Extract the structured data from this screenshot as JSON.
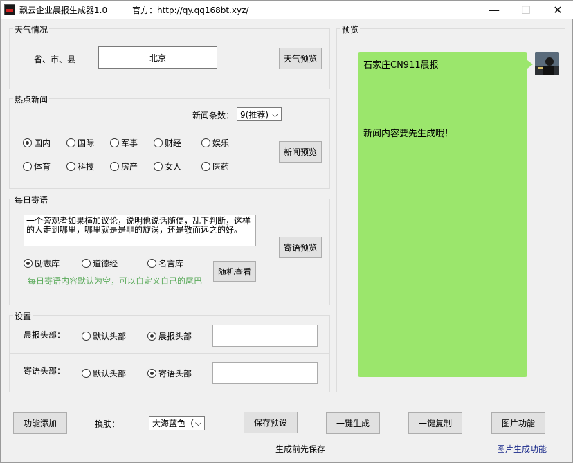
{
  "window": {
    "title": "飘云企业晨报生成器1.0",
    "official_site": "官方：http://qy.qq168bt.xyz/",
    "minimize": "—",
    "maximize": "☐",
    "close": "✕"
  },
  "weather": {
    "group_label": "天气情况",
    "location_label": "省、市、县",
    "location_value": "北京",
    "preview_button": "天气预览"
  },
  "news": {
    "group_label": "热点新闻",
    "count_label": "新闻条数：",
    "count_value": "9(推荐)",
    "categories": [
      {
        "label": "国内",
        "checked": true
      },
      {
        "label": "国际",
        "checked": false
      },
      {
        "label": "军事",
        "checked": false
      },
      {
        "label": "财经",
        "checked": false
      },
      {
        "label": "娱乐",
        "checked": false
      },
      {
        "label": "体育",
        "checked": false
      },
      {
        "label": "科技",
        "checked": false
      },
      {
        "label": "房产",
        "checked": false
      },
      {
        "label": "女人",
        "checked": false
      },
      {
        "label": "医药",
        "checked": false
      }
    ],
    "preview_button": "新闻预览"
  },
  "daily": {
    "group_label": "每日寄语",
    "sentence": "一个旁观者如果横加议论，说明他说话随便，乱下判断，这样的人走到哪里，哪里就是是非的旋涡，还是敬而远之的好。",
    "sources": [
      {
        "label": "励志库",
        "checked": true
      },
      {
        "label": "道德经",
        "checked": false
      },
      {
        "label": "名言库",
        "checked": false
      }
    ],
    "random_button": "随机查看",
    "preview_button": "寄语预览",
    "hint": "每日寄语内容默认为空，可以自定义自己的尾巴"
  },
  "settings": {
    "group_label": "设置",
    "morning_header_label": "晨报头部：",
    "morning_default": "默认头部",
    "morning_custom": "晨报头部",
    "morning_selected": "custom",
    "sentence_header_label": "寄语头部：",
    "sentence_default": "默认头部",
    "sentence_custom": "寄语头部",
    "sentence_selected": "custom"
  },
  "preview": {
    "group_label": "预览",
    "bubble_title": "石家庄CN911晨报",
    "bubble_body": "新闻内容要先生成哦！",
    "bubble_color": "#9be66c"
  },
  "bottom": {
    "add_function_button": "功能添加",
    "skin_label": "换肤：",
    "skin_value": "大海蓝色（",
    "save_preset_button": "保存预设",
    "generate_button": "一键生成",
    "copy_button": "一键复制",
    "image_function_button": "图片功能",
    "save_hint": "生成前先保存",
    "image_generate_link": "图片生成功能",
    "link_color": "#1a2a8a"
  }
}
